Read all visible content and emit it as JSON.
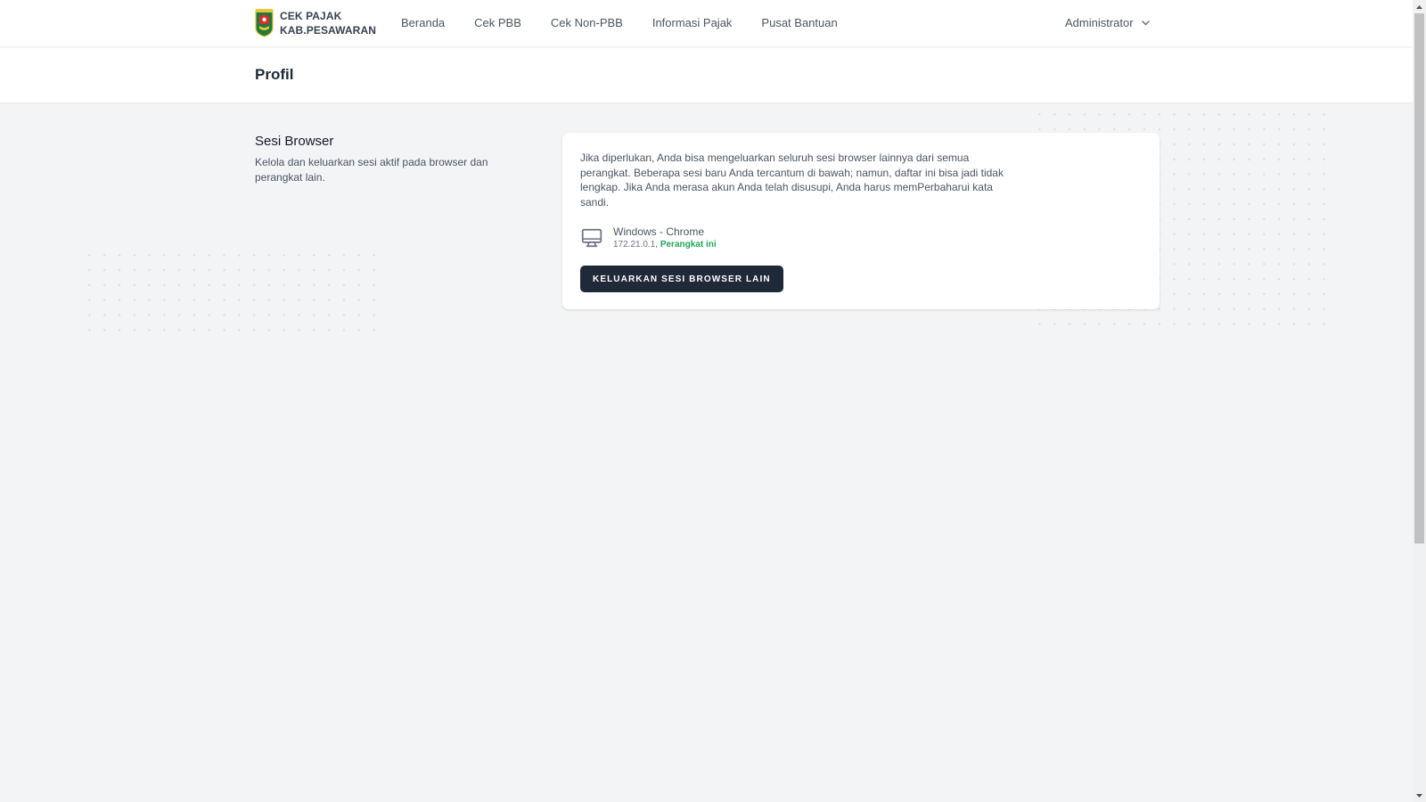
{
  "app": {
    "brand_line1": "CEK PAJAK",
    "brand_line2": "KAB.PESAWARAN",
    "logo": "pesawaran-crest-logo"
  },
  "nav": {
    "items": [
      {
        "label": "Beranda"
      },
      {
        "label": "Cek PBB"
      },
      {
        "label": "Cek Non-PBB"
      },
      {
        "label": "Informasi Pajak"
      },
      {
        "label": "Pusat Bantuan"
      }
    ],
    "user": {
      "label": "Administrator",
      "icon": "chevron-down-icon"
    }
  },
  "page": {
    "title": "Profil"
  },
  "browser_sessions": {
    "title": "Sesi Browser",
    "description": "Kelola dan keluarkan sesi aktif pada browser dan perangkat lain.",
    "info": "Jika diperlukan, Anda bisa mengeluarkan seluruh sesi browser lainnya dari semua perangkat. Beberapa sesi baru Anda tercantum di bawah; namun, daftar ini bisa jadi tidak lengkap. Jika Anda merasa akun Anda telah disusupi, Anda harus memPerbaharui kata sandi.",
    "sessions": [
      {
        "device": "Windows - Chrome",
        "ip": "172.21.0.1,",
        "current_label": "Perangkat ini",
        "icon": "monitor-icon"
      }
    ],
    "logout_button": "KELUARKAN SESI BROWSER LAIN"
  },
  "colors": {
    "accent_green": "#22a55a",
    "button_dark": "#1f2937",
    "background": "#f3f4f6"
  }
}
